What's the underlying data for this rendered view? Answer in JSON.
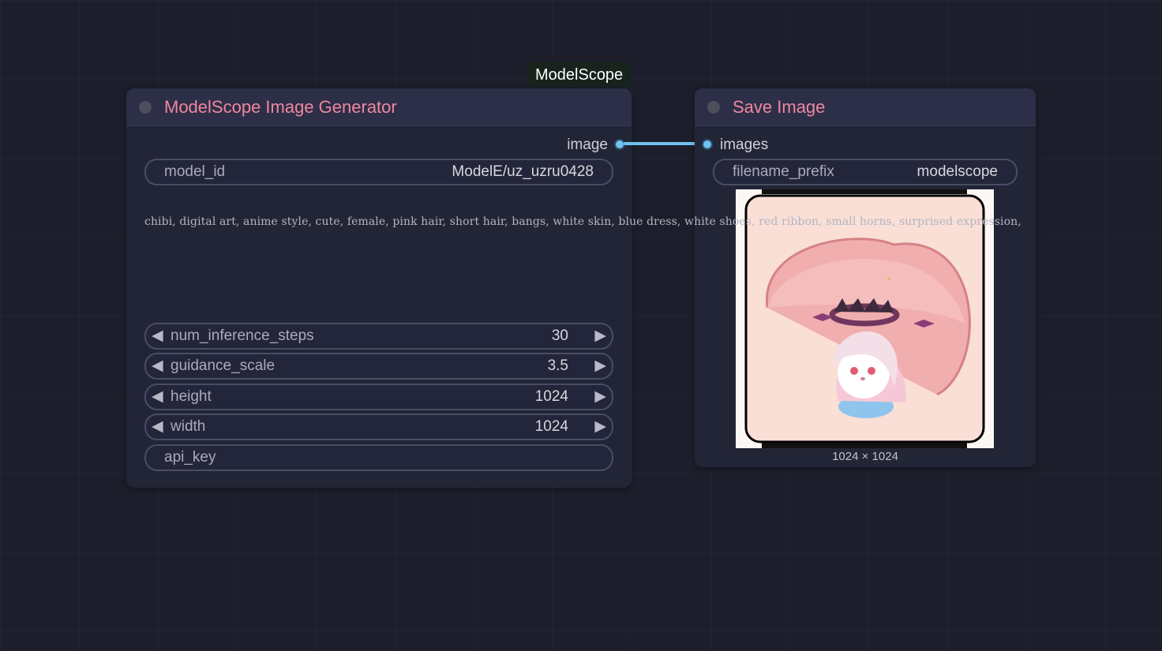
{
  "group": {
    "label": "ModelScope"
  },
  "generator_node": {
    "title": "ModelScope Image Generator",
    "output_label": "image",
    "model_id": {
      "label": "model_id",
      "value": "ModelE/uz_uzru0428"
    },
    "prompt": "chibi, digital art, anime style, cute, female, pink hair, short hair, bangs, white skin, blue dress, white shoes, red ribbon, small horns, surprised expression,",
    "widgets": [
      {
        "label": "num_inference_steps",
        "value": "30"
      },
      {
        "label": "guidance_scale",
        "value": "3.5"
      },
      {
        "label": "height",
        "value": "1024"
      },
      {
        "label": "width",
        "value": "1024"
      }
    ],
    "api_key": {
      "label": "api_key"
    }
  },
  "save_node": {
    "title": "Save Image",
    "input_label": "images",
    "filename_prefix": {
      "label": "filename_prefix",
      "value": "modelscope"
    },
    "image_size": "1024 × 1024"
  },
  "icons": {
    "arrow_left": "◀",
    "arrow_right": "▶"
  },
  "colors": {
    "title": "#f0879f",
    "link": "#6ec3ef",
    "background": "#1c1e2b"
  }
}
